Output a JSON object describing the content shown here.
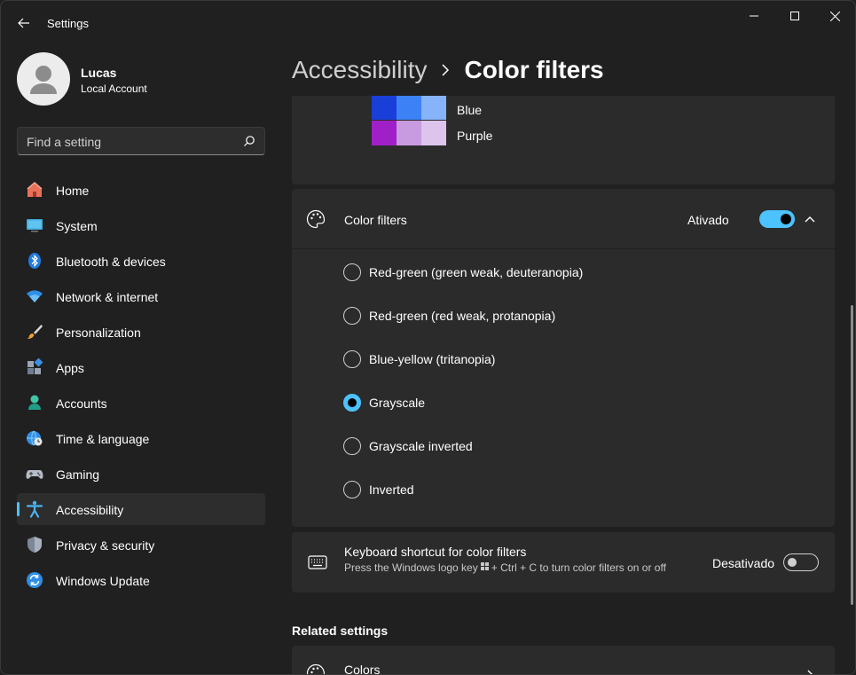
{
  "window": {
    "title": "Settings",
    "accent_color": "#4cc2ff"
  },
  "profile": {
    "name": "Lucas",
    "account_type": "Local Account"
  },
  "search": {
    "placeholder": "Find a setting"
  },
  "sidebar": {
    "items": [
      {
        "label": "Home",
        "icon": "home-icon"
      },
      {
        "label": "System",
        "icon": "system-icon"
      },
      {
        "label": "Bluetooth & devices",
        "icon": "bluetooth-icon"
      },
      {
        "label": "Network & internet",
        "icon": "network-icon"
      },
      {
        "label": "Personalization",
        "icon": "brush-icon"
      },
      {
        "label": "Apps",
        "icon": "apps-icon"
      },
      {
        "label": "Accounts",
        "icon": "accounts-icon"
      },
      {
        "label": "Time & language",
        "icon": "globe-clock-icon"
      },
      {
        "label": "Gaming",
        "icon": "gamepad-icon"
      },
      {
        "label": "Accessibility",
        "icon": "accessibility-icon",
        "active": true
      },
      {
        "label": "Privacy & security",
        "icon": "shield-icon"
      },
      {
        "label": "Windows Update",
        "icon": "update-icon"
      }
    ]
  },
  "breadcrumb": {
    "parent": "Accessibility",
    "current": "Color filters"
  },
  "swatches": [
    {
      "label": "Blue",
      "colors": [
        "#1a3fd8",
        "#3c82f6",
        "#86b3f9"
      ]
    },
    {
      "label": "Purple",
      "colors": [
        "#a020c8",
        "#c89ae0",
        "#dcc4ec"
      ]
    }
  ],
  "color_filters": {
    "title": "Color filters",
    "toggle_state": "Ativado",
    "toggle_on": true,
    "options": [
      {
        "label": "Red-green (green weak, deuteranopia)",
        "selected": false
      },
      {
        "label": "Red-green (red weak, protanopia)",
        "selected": false
      },
      {
        "label": "Blue-yellow (tritanopia)",
        "selected": false
      },
      {
        "label": "Grayscale",
        "selected": true
      },
      {
        "label": "Grayscale inverted",
        "selected": false
      },
      {
        "label": "Inverted",
        "selected": false
      }
    ]
  },
  "shortcut": {
    "title": "Keyboard shortcut for color filters",
    "desc_before": "Press the Windows logo key",
    "desc_after": "+ Ctrl + C to turn color filters on or off",
    "toggle_state": "Desativado",
    "toggle_on": false
  },
  "related": {
    "title": "Related settings",
    "colors_label": "Colors"
  }
}
